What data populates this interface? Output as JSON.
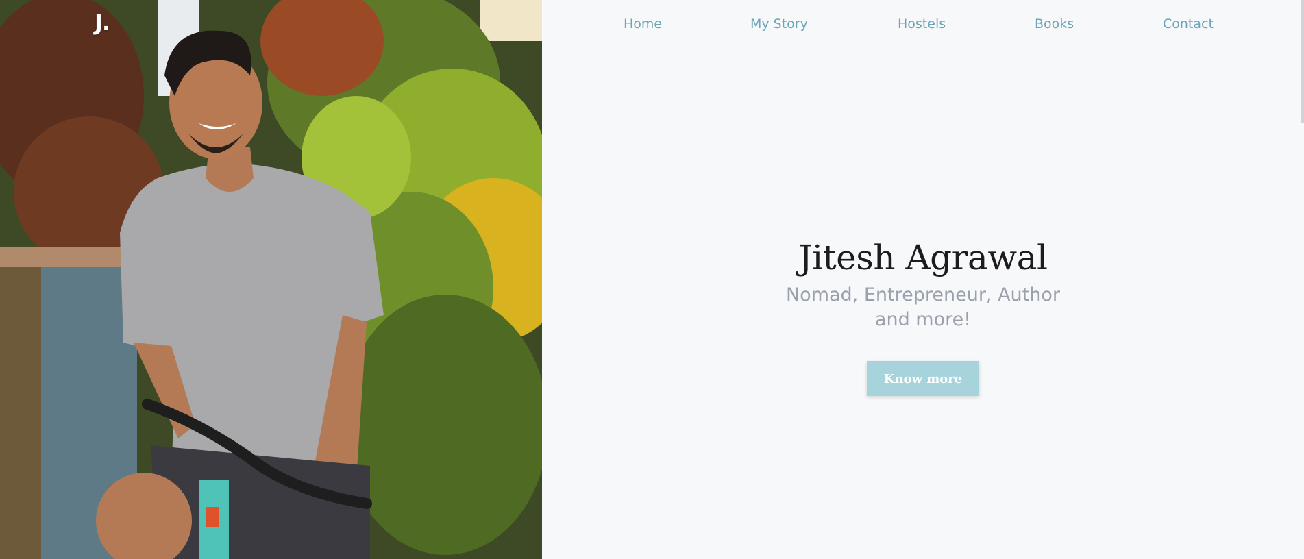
{
  "brand": {
    "logo_text": "J."
  },
  "nav": {
    "items": [
      {
        "label": "Home"
      },
      {
        "label": "My Story"
      },
      {
        "label": "Hostels"
      },
      {
        "label": "Books"
      },
      {
        "label": "Contact"
      }
    ]
  },
  "hero": {
    "name": "Jitesh Agrawal",
    "tagline": "Nomad, Entrepreneur, Author and more!",
    "cta_label": "Know more"
  },
  "colors": {
    "accent": "#6aa6b8",
    "button_bg": "#a7d4dc",
    "heading": "#1c1c1c",
    "tagline": "#9aa0ac",
    "background": "#f7f8fa"
  }
}
